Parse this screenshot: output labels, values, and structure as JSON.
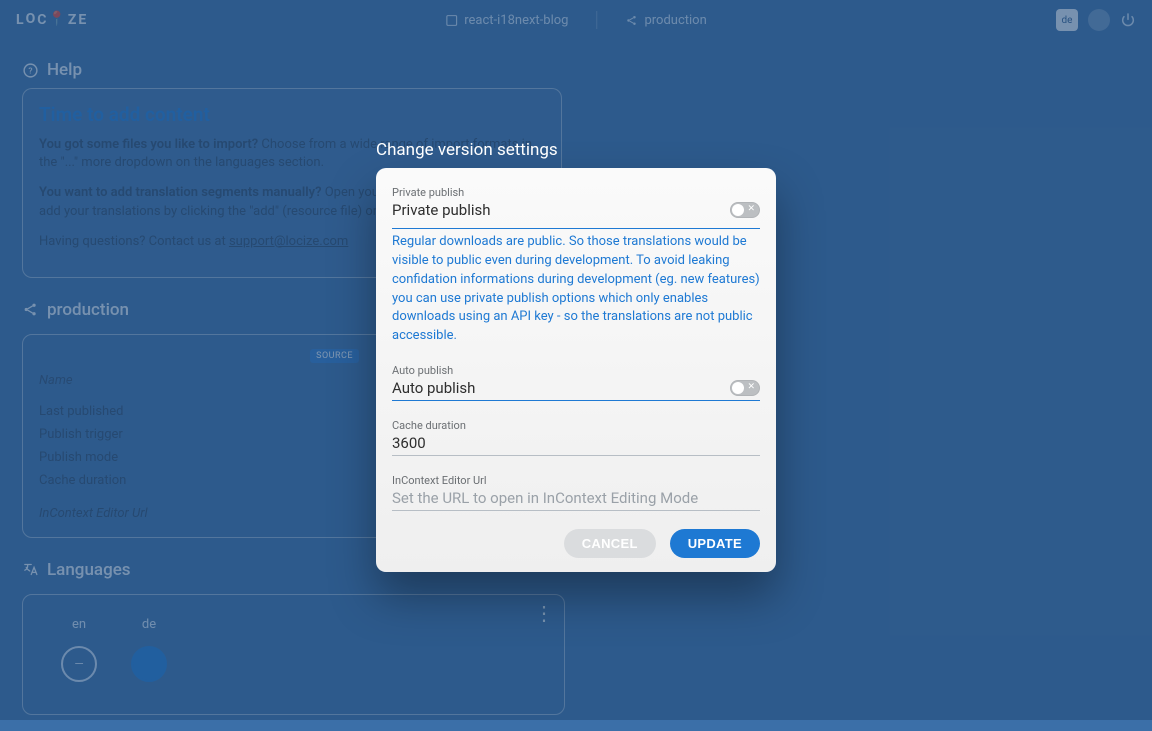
{
  "topbar": {
    "logo": "LOCIZE",
    "project": "react-i18next-blog",
    "version": "production",
    "badge": "de"
  },
  "help": {
    "section_label": "Help",
    "heading": "Time to add content",
    "p1_bold": "You got some files you like to import?",
    "p1_rest": " Choose from a wide range of import formats in the \"...\" more dropdown on the languages section.",
    "p2_bold": "You want to add translation segments manually?",
    "p2_rest": " Open your source language below and add your translations by clicking the \"add\" (resource file) on the next page.",
    "p3_pre": "Having questions? Contact us at ",
    "p3_link": "support@locize.com"
  },
  "production": {
    "section_label": "production",
    "badge": "SOURCE",
    "header": "Name",
    "rows": [
      "Last published",
      "Publish trigger",
      "Publish mode",
      "Cache duration"
    ],
    "footer": "InContext Editor Url"
  },
  "languages": {
    "section_label": "Languages",
    "items": [
      "en",
      "de"
    ]
  },
  "modal": {
    "title": "Change version settings",
    "private_publish": {
      "small": "Private publish",
      "label": "Private publish",
      "help": "Regular downloads are public. So those translations would be visible to public even during development. To avoid leaking confidation informations during development (eg. new features) you can use private publish options which only enables downloads using an API key - so the translations are not public accessible."
    },
    "auto_publish": {
      "small": "Auto publish",
      "label": "Auto publish"
    },
    "cache": {
      "small": "Cache duration",
      "value": "3600"
    },
    "incontext": {
      "small": "InContext Editor Url",
      "placeholder": "Set the URL to open in InContext Editing Mode"
    },
    "cancel": "CANCEL",
    "update": "UPDATE"
  }
}
